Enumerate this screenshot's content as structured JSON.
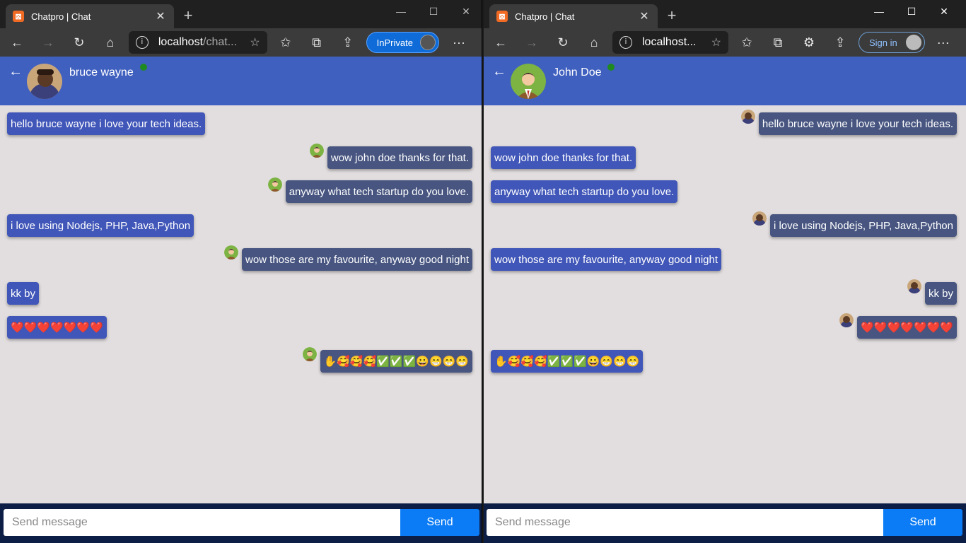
{
  "left": {
    "tab_title": "Chatpro | Chat",
    "url_host": "localhost",
    "url_rest": "/chat...",
    "profile_button": "InPrivate",
    "contact_name": "bruce wayne",
    "input_placeholder": "Send message",
    "send_label": "Send",
    "messages": [
      {
        "text": "hello bruce wayne i love your tech ideas.",
        "side": "received"
      },
      {
        "text": "wow john doe thanks for that.",
        "side": "sent"
      },
      {
        "text": "anyway what tech startup do you love.",
        "side": "sent"
      },
      {
        "text": "i love using Nodejs, PHP, Java,Python",
        "side": "received"
      },
      {
        "text": "wow those are my favourite, anyway good night",
        "side": "sent"
      },
      {
        "text": "kk by",
        "side": "received"
      },
      {
        "text": "❤️❤️❤️❤️❤️❤️❤️",
        "side": "received"
      },
      {
        "text": "✋🥰🥰🥰✅✅✅😀😁😁😁",
        "side": "sent"
      }
    ]
  },
  "right": {
    "tab_title": "Chatpro | Chat",
    "url_host": "localhost...",
    "profile_button": "Sign in",
    "contact_name": "John Doe",
    "input_placeholder": "Send message",
    "send_label": "Send",
    "messages": [
      {
        "text": "hello bruce wayne i love your tech ideas.",
        "side": "sent"
      },
      {
        "text": "wow john doe thanks for that.",
        "side": "received"
      },
      {
        "text": "anyway what tech startup do you love.",
        "side": "received"
      },
      {
        "text": "i love using Nodejs, PHP, Java,Python",
        "side": "sent"
      },
      {
        "text": "wow those are my favourite, anyway good night",
        "side": "received"
      },
      {
        "text": "kk by",
        "side": "sent"
      },
      {
        "text": "❤️❤️❤️❤️❤️❤️❤️",
        "side": "sent"
      },
      {
        "text": "✋🥰🥰🥰✅✅✅😀😁😁😁",
        "side": "received"
      }
    ]
  },
  "colors": {
    "header": "#4060bf",
    "received_bubble": "#4056b8",
    "sent_bubble": "#475580",
    "send_button": "#0b7cf5",
    "online": "#1f8a1f"
  }
}
